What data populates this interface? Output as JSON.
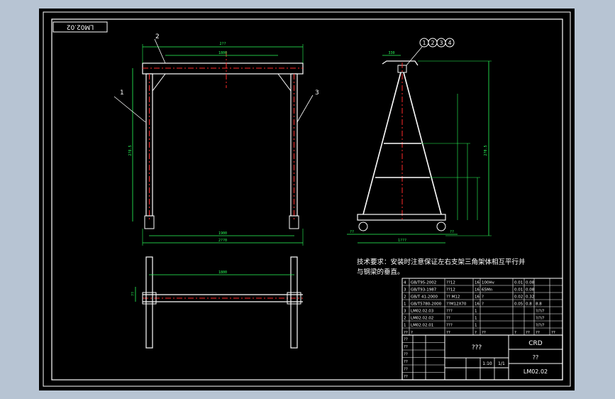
{
  "colors": {
    "background": "#b7c4d3",
    "sheet": "#000000",
    "frame": "#ffffff",
    "outline": "#ffffff",
    "dimension": "#2aff5a",
    "centerline": "#ff2a2a",
    "leader": "#00e5ff"
  },
  "drawing_number_stamp": "LM02.02",
  "callouts": {
    "front": [
      "1",
      "2",
      "3"
    ],
    "side": [
      "1",
      "2",
      "3",
      "4"
    ]
  },
  "dimensions": {
    "front_top_outer": "2??",
    "front_top_inner": "1800",
    "front_height": "2?8.5",
    "front_bottom_inner": "1900",
    "front_bottom_outer": "2??0",
    "side_top": "330",
    "side_total_height": "2?0.5",
    "side_bottom_left": "??",
    "side_bottom_total": "1???",
    "side_bottom_right": "??",
    "plan_width": "1800",
    "plan_depth": "??"
  },
  "tech_requirements": {
    "line1": "技术要求：安装时注意保证左右支架三角架体相互平行并",
    "line2": "与钢梁的垂直。"
  },
  "parts_list": [
    {
      "no": "4",
      "code": "GB/T95-2002",
      "name": "??12",
      "qty": "16",
      "material": "100Hv",
      "w1": "0.01",
      "w2": "0.08",
      "note": ""
    },
    {
      "no": "3",
      "code": "GB/T93-1987",
      "name": "??12",
      "qty": "16",
      "material": "65Mn",
      "w1": "0.01",
      "w2": "0.08",
      "note": ""
    },
    {
      "no": "2",
      "code": "GB/T 41-2000",
      "name": "?? M12",
      "qty": "16",
      "material": "?",
      "w1": "0.02",
      "w2": "0.32",
      "note": ""
    },
    {
      "no": "1",
      "code": "GB/T5780-2000",
      "name": "??M12X70",
      "qty": "16",
      "material": "?",
      "w1": "0.05",
      "w2": "0.8",
      "note": "8.8"
    },
    {
      "no": "3",
      "code": "LM02.02.03",
      "name": "???",
      "qty": "1",
      "material": "",
      "w1": "",
      "w2": "",
      "note": "?/?/?"
    },
    {
      "no": "2",
      "code": "LM02.02.02",
      "name": "??",
      "qty": "1",
      "material": "",
      "w1": "",
      "w2": "",
      "note": "?/?/?"
    },
    {
      "no": "1",
      "code": "LM02.02.01",
      "name": "???",
      "qty": "1",
      "material": "",
      "w1": "",
      "w2": "",
      "note": "?/?/?"
    }
  ],
  "parts_header": [
    "??",
    "?",
    "??",
    "?",
    "??",
    "?",
    "??",
    "??",
    "??"
  ],
  "title_block": {
    "part_name": "???",
    "material": "CRD",
    "company": "??",
    "drawing_no": "LM02.02",
    "scale": "1:10",
    "sheet": "1/1",
    "row_labels": [
      "??",
      "??",
      "??",
      "??",
      "??",
      "??"
    ]
  }
}
